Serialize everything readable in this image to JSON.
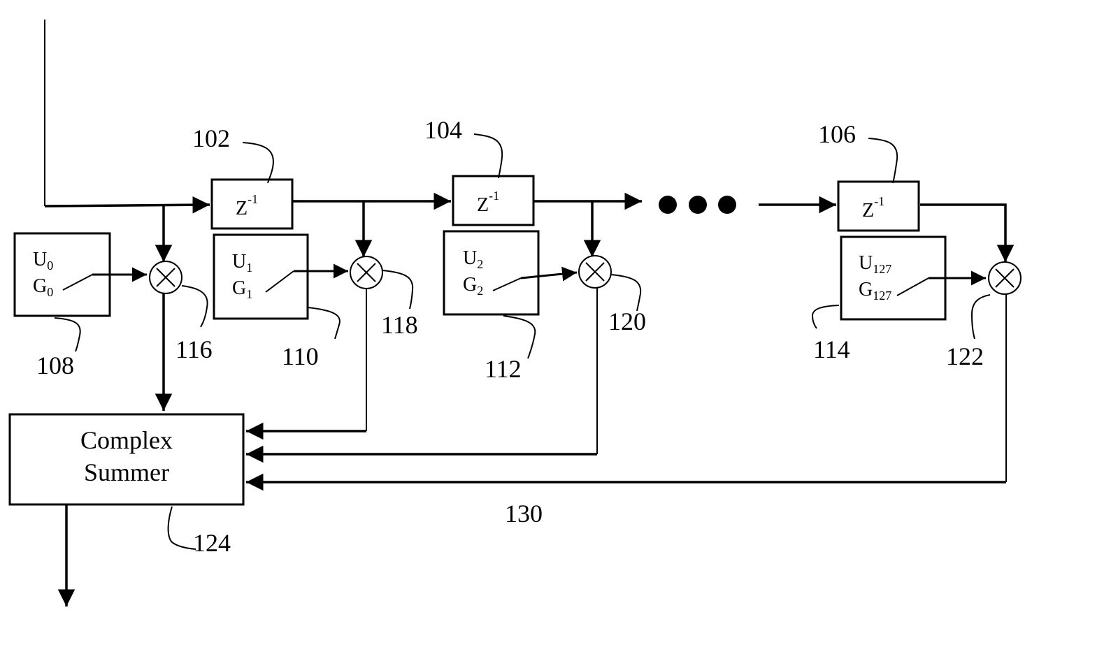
{
  "diagram": {
    "type": "FIR filter / delay-line block diagram",
    "delays": [
      {
        "ref": "102",
        "label": "Z",
        "exp": "-1"
      },
      {
        "ref": "104",
        "label": "Z",
        "exp": "-1"
      },
      {
        "ref": "106",
        "label": "Z",
        "exp": "-1"
      }
    ],
    "coefficients": [
      {
        "ref": "108",
        "u": "U",
        "g": "G",
        "sub": "0"
      },
      {
        "ref": "110",
        "u": "U",
        "g": "G",
        "sub": "1"
      },
      {
        "ref": "112",
        "u": "U",
        "g": "G",
        "sub": "2"
      },
      {
        "ref": "114",
        "u": "U",
        "g": "G",
        "sub": "127"
      }
    ],
    "multipliers": [
      {
        "ref": "116",
        "symbol": "×"
      },
      {
        "ref": "118",
        "symbol": "×"
      },
      {
        "ref": "120",
        "symbol": "×"
      },
      {
        "ref": "122",
        "symbol": "×"
      }
    ],
    "summer": {
      "ref": "124",
      "line1": "Complex",
      "line2": "Summer"
    },
    "bus_ref": "130"
  }
}
